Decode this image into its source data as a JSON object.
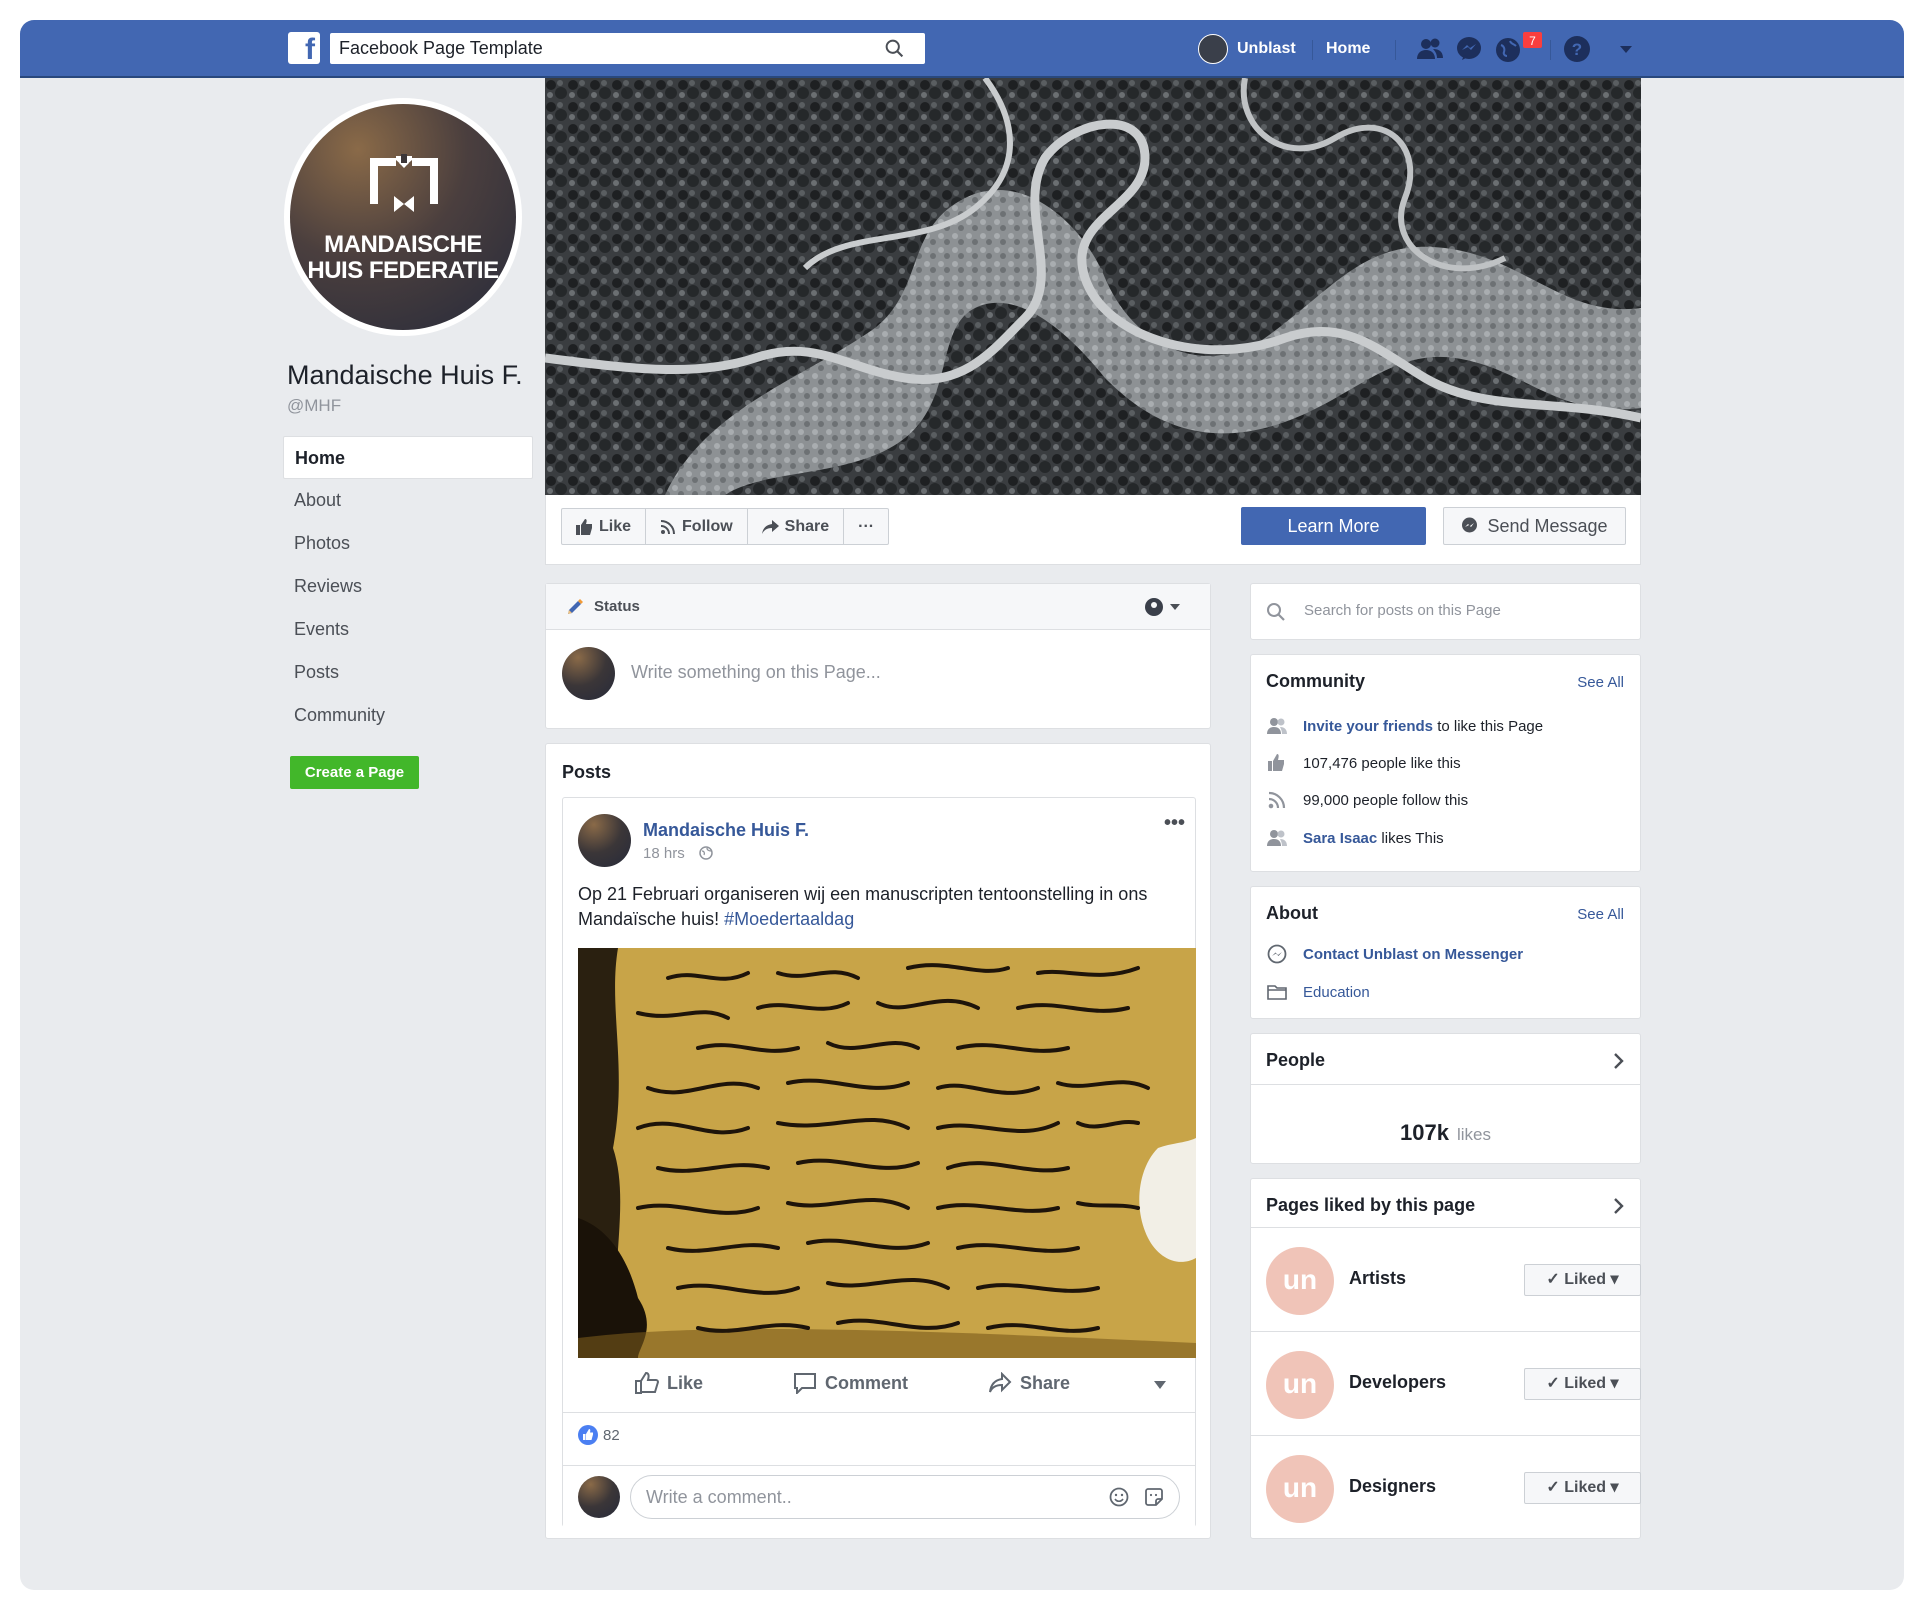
{
  "topbar": {
    "logo_letter": "f",
    "search_value": "Facebook Page Template",
    "user_name": "Unblast",
    "home_label": "Home",
    "notification_count": "7",
    "accent_color": "#4267b2"
  },
  "page": {
    "name": "Mandaische Huis F.",
    "handle": "@MHF",
    "logo_text_line1": "MANDAISCHE",
    "logo_text_line2": "HUIS FEDERATIE"
  },
  "nav": {
    "items": [
      {
        "label": "Home",
        "active": true
      },
      {
        "label": "About"
      },
      {
        "label": "Photos"
      },
      {
        "label": "Reviews"
      },
      {
        "label": "Events"
      },
      {
        "label": "Posts"
      },
      {
        "label": "Community"
      }
    ],
    "create_button": "Create a Page"
  },
  "actions": {
    "like": "Like",
    "follow": "Follow",
    "share": "Share",
    "more": "···",
    "learn_more": "Learn More",
    "send_message": "Send Message"
  },
  "status": {
    "tab_label": "Status",
    "placeholder": "Write something on this Page..."
  },
  "posts": {
    "heading": "Posts",
    "post": {
      "author": "Mandaische Huis F.",
      "time": "18 hrs",
      "text": "Op 21 Februari organiseren wij een manuscripten tentoonstelling in ons Mandaïsche huis!",
      "hashtag": "#Moedertaaldag",
      "like_label": "Like",
      "comment_label": "Comment",
      "share_label": "Share",
      "reaction_count": "82",
      "comment_placeholder": "Write a comment.."
    }
  },
  "sidebar": {
    "search_placeholder": "Search for posts on this Page",
    "community": {
      "title": "Community",
      "see_all": "See All",
      "invite_link": "Invite your friends",
      "invite_rest": "to like this Page",
      "likes_text": "107,476 people like this",
      "follow_text": "99,000 people follow this",
      "friend_name": "Sara Isaac",
      "friend_rest": "likes This"
    },
    "about": {
      "title": "About",
      "see_all": "See All",
      "messenger_link": "Contact Unblast on Messenger",
      "category": "Education"
    },
    "people": {
      "title": "People",
      "count": "107k",
      "unit": "likes"
    },
    "pages_liked": {
      "title": "Pages liked by this page",
      "items": [
        {
          "name": "Artists",
          "button": "Liked"
        },
        {
          "name": "Developers",
          "button": "Liked"
        },
        {
          "name": "Designers",
          "button": "Liked"
        }
      ],
      "logo_text": "un"
    }
  }
}
